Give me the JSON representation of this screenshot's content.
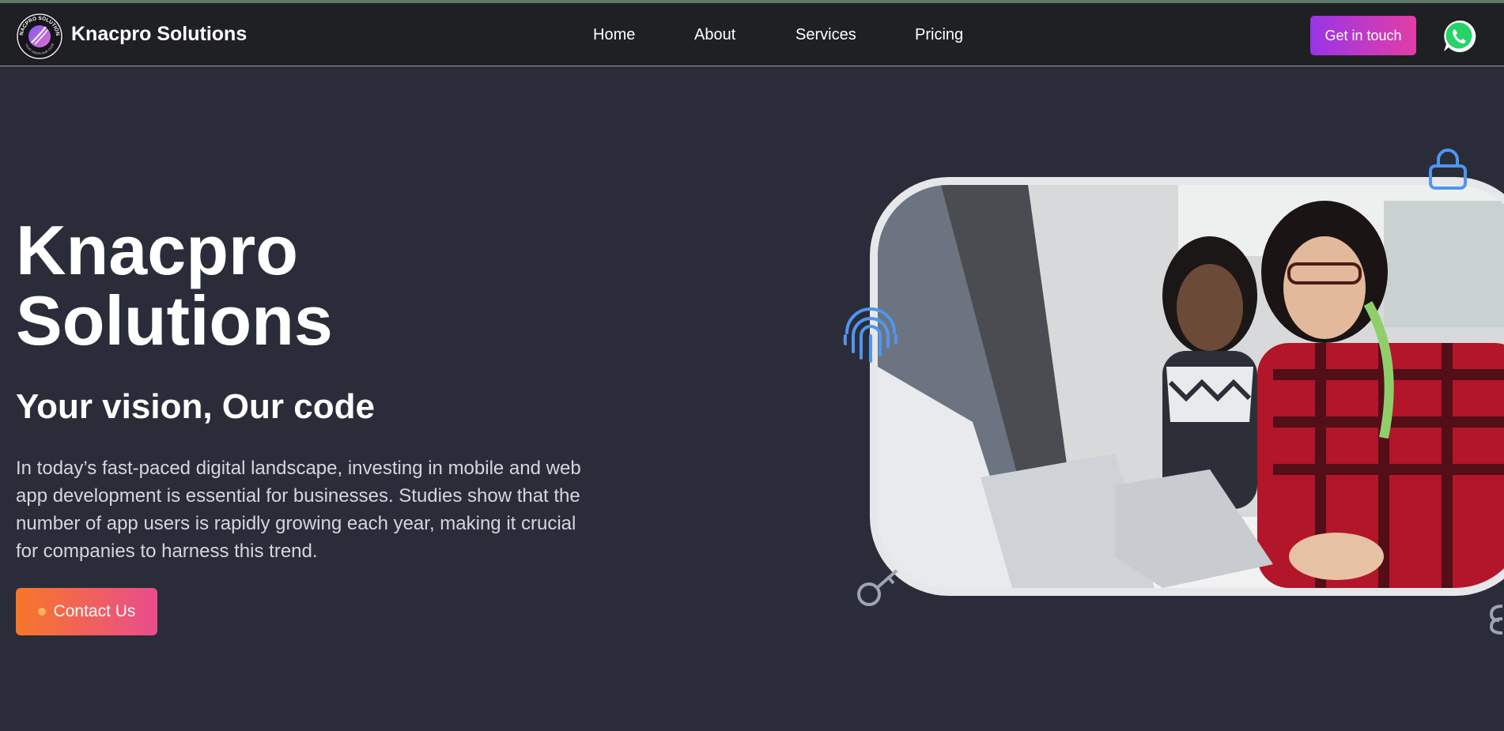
{
  "nav": {
    "brand": "Knacpro Solutions",
    "logo_ring_text": "KNACPRO SOLUTIONS",
    "logo_tagline": "YOUR VISION OUR CODE",
    "links": [
      "Home",
      "About",
      "Services",
      "Pricing"
    ],
    "cta_label": "Get in touch",
    "whatsapp_icon": "whatsapp-icon"
  },
  "hero": {
    "title": "Knacpro Solutions",
    "subtitle": "Your vision, Our code",
    "body": "In today’s fast-paced digital landscape, investing in mobile and web app development is essential for businesses. Studies show that the number of app users is rapidly growing each year, making it crucial for companies to harness this trend.",
    "button_label": "Contact Us",
    "decor_icons": [
      "lock-icon",
      "fingerprint-icon",
      "key-icon",
      "link-icon"
    ]
  },
  "colors": {
    "background": "#2a2d39",
    "navbar": "#1f2024",
    "cta_gradient": [
      "#9a34e6",
      "#e23ea6"
    ],
    "contact_gradient": [
      "#f77728",
      "#ea4c8d"
    ],
    "icon_blue": "#4f96f0",
    "whatsapp_green": "#25d366"
  }
}
